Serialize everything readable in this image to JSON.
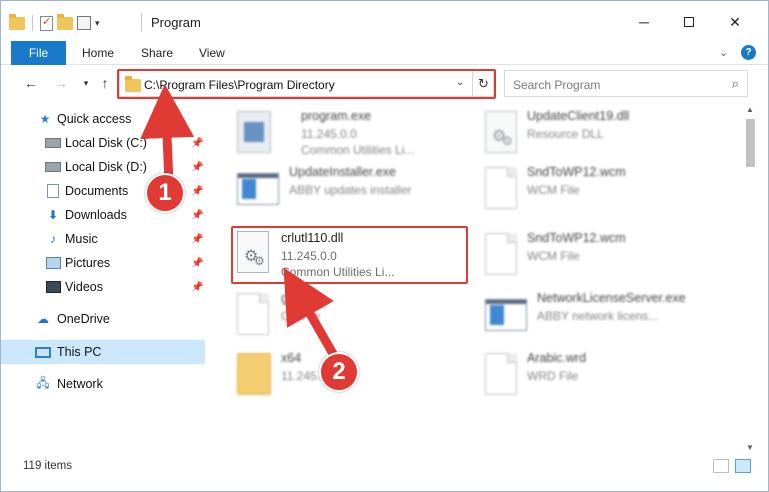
{
  "window": {
    "title": "Program"
  },
  "ribbon": {
    "tabs": [
      "File",
      "Home",
      "Share",
      "View"
    ]
  },
  "address": {
    "path": "C:\\Program Files\\Program Directory"
  },
  "search": {
    "placeholder": "Search Program"
  },
  "sidebar": {
    "items": [
      {
        "label": "Quick access",
        "icon": "star-icon"
      },
      {
        "label": "Local Disk (C:)",
        "icon": "disk-icon",
        "pinned": true
      },
      {
        "label": "Local Disk (D:)",
        "icon": "disk-icon",
        "pinned": true
      },
      {
        "label": "Documents",
        "icon": "documents-icon",
        "pinned": true
      },
      {
        "label": "Downloads",
        "icon": "download-icon",
        "pinned": true
      },
      {
        "label": "Music",
        "icon": "music-icon",
        "pinned": true
      },
      {
        "label": "Pictures",
        "icon": "pictures-icon",
        "pinned": true
      },
      {
        "label": "Videos",
        "icon": "videos-icon",
        "pinned": true
      },
      {
        "label": "OneDrive",
        "icon": "cloud-icon"
      },
      {
        "label": "This PC",
        "icon": "computer-icon",
        "selected": true
      },
      {
        "label": "Network",
        "icon": "network-icon"
      }
    ]
  },
  "files": [
    {
      "name": "program.exe",
      "line1": "11.245.0.0",
      "line2": "Common Utilities Li...",
      "icon": "exe-icon"
    },
    {
      "name": "UpdateClient19.dll",
      "line1": "Resource DLL",
      "line2": "",
      "icon": "dll-gear-icon"
    },
    {
      "name": "UpdateInstaller.exe",
      "line1": "ABBY updates installer",
      "line2": "",
      "icon": "app-window-icon"
    },
    {
      "name": "SndToWP12.wcm",
      "line1": "WCM File",
      "line2": "",
      "icon": "document-icon"
    },
    {
      "name": "crlutl110.dll",
      "line1": "11.245.0.0",
      "line2": "Common Utilities Li...",
      "icon": "dll-gear-icon",
      "highlighted": true
    },
    {
      "name": "SndToWP12.wcm",
      "line1": "WCM File",
      "line2": "",
      "icon": "document-icon"
    },
    {
      "name": "gb.lex",
      "line1": "CK File",
      "line2": "",
      "icon": "document-icon"
    },
    {
      "name": "NetworkLicenseServer.exe",
      "line1": "ABBY network licens...",
      "line2": "",
      "icon": "app-window-icon"
    },
    {
      "name": "x64",
      "line1": "11.245.0.0",
      "line2": "",
      "icon": "folder-icon"
    },
    {
      "name": "Arabic.wrd",
      "line1": "WRD File",
      "line2": "",
      "icon": "document-icon"
    }
  ],
  "status": {
    "items_count": "119 items"
  },
  "annotations": {
    "step1": "1",
    "step2": "2"
  },
  "colors": {
    "accent": "#1979ca",
    "highlight": "#e03a35",
    "selected": "#cce8ff"
  }
}
